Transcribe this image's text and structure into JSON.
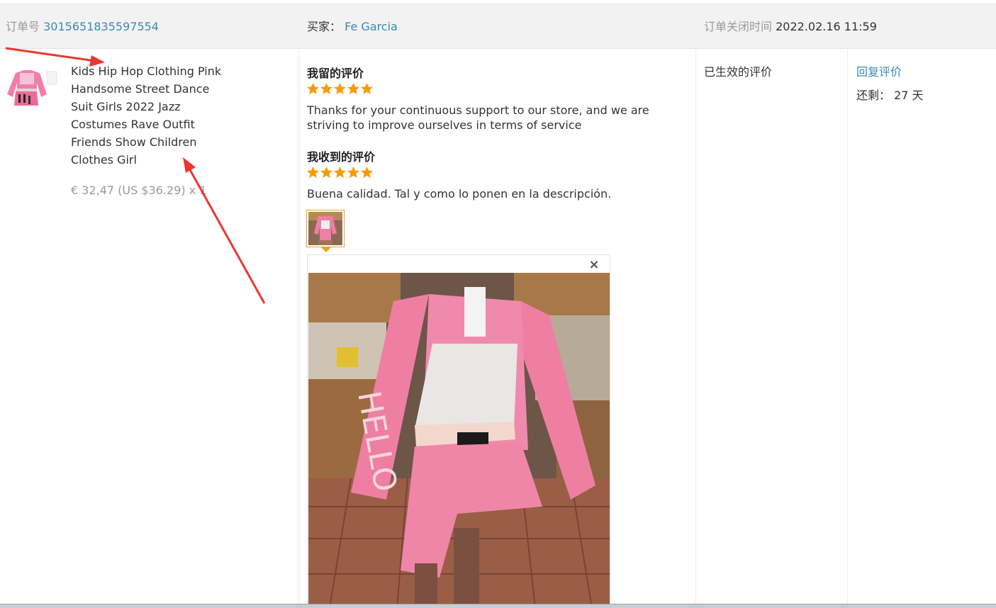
{
  "header": {
    "order_label": "订单号",
    "order_number": "3015651835597554",
    "buyer_label": "买家：",
    "buyer_name": "Fe Garcia",
    "close_time_label": "订单关闭时间",
    "close_time_value": "2022.02.16 11:59"
  },
  "product": {
    "title": "Kids Hip Hop Clothing Pink Handsome Street Dance Suit Girls 2022 Jazz Costumes Rave Outfit Friends Show Children Clothes Girl",
    "price": "€ 32,47 (US $36.29) x 1"
  },
  "my_review": {
    "title": "我留的评价",
    "stars": 5,
    "text": "Thanks for your continuous support to our store, and we are striving to improve ourselves in terms of service"
  },
  "received_review": {
    "title": "我收到的评价",
    "stars": 5,
    "text": "Buena calidad. Tal y como lo ponen en la descripción."
  },
  "preview": {
    "close_label": "×"
  },
  "status": {
    "text": "已生效的评价"
  },
  "actions": {
    "reply_label": "回复评价",
    "remaining": "还剩： 27 天"
  },
  "colors": {
    "link": "#3a8ab7",
    "star": "#f79b00",
    "header_bg": "#f2f2f2",
    "arrow": "#e8382f",
    "thumb_border": "#e8a31c"
  },
  "icons": [
    "star-icon",
    "close-icon"
  ]
}
